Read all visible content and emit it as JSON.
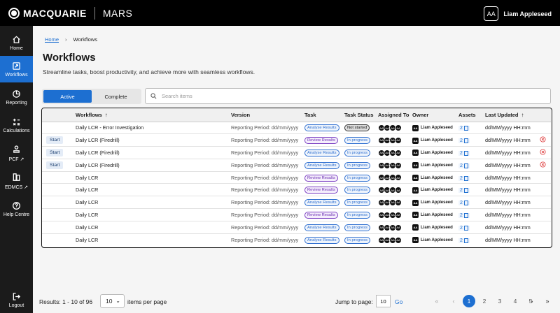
{
  "header": {
    "brand": "MACQUARIE",
    "app": "MARS",
    "user_initials": "AA",
    "user_name": "Liam Appleseed"
  },
  "sidebar": {
    "items": [
      {
        "label": "Home",
        "icon": "home-icon",
        "active": false
      },
      {
        "label": "Workflows",
        "icon": "workflow-icon",
        "active": true
      },
      {
        "label": "Reporting",
        "icon": "chart-icon",
        "active": false
      },
      {
        "label": "Calculations",
        "icon": "calculator-icon",
        "active": false
      },
      {
        "label": "PCF",
        "icon": "person-icon",
        "active": false,
        "external": true
      },
      {
        "label": "EDMCS",
        "icon": "building-icon",
        "active": false,
        "external": true
      },
      {
        "label": "Help Centre",
        "icon": "help-icon",
        "active": false
      }
    ],
    "logout": "Logout"
  },
  "breadcrumb": {
    "home": "Home",
    "current": "Workflows"
  },
  "page": {
    "title": "Workflows",
    "subtitle": "Streamline tasks, boost productivity, and achieve more with seamless workflows."
  },
  "tabs": {
    "active": "Active",
    "complete": "Complete"
  },
  "search": {
    "placeholder": "Search items",
    "value": ""
  },
  "table": {
    "columns": [
      "Workflows",
      "Version",
      "Task",
      "Task Status",
      "Assigned To",
      "Owner",
      "Assets",
      "Last Updated"
    ],
    "rows": [
      {
        "start": "",
        "workflow": "Daily LCR - Error Investigation",
        "version": "Reporting Period: dd/mm/yyyy",
        "task": "Analyse Results",
        "status": "Not started",
        "assignees": [
          "AA",
          "AA",
          "AA",
          "AA"
        ],
        "owner_initials": "AA",
        "owner": "Liam Appleseed",
        "assets": "2",
        "updated": "dd/MM/yyyy HH:mm",
        "removable": false
      },
      {
        "start": "Start",
        "workflow": "Daily LCR (Firedrill)",
        "version": "Reporting Period: dd/mm/yyyy",
        "task": "Review Results",
        "status": "In progress",
        "assignees": [
          "AA",
          "AA",
          "AA",
          "AA"
        ],
        "owner_initials": "AA",
        "owner": "Liam Appleseed",
        "assets": "2",
        "updated": "dd/MM/yyyy HH:mm",
        "removable": true
      },
      {
        "start": "Start",
        "workflow": "Daily LCR (Firedrill)",
        "version": "Reporting Period: dd/mm/yyyy",
        "task": "Analyse Results",
        "status": "In progress",
        "assignees": [
          "AA",
          "AA",
          "AA",
          "AA"
        ],
        "owner_initials": "AA",
        "owner": "Liam Appleseed",
        "assets": "2",
        "updated": "dd/MM/yyyy HH:mm",
        "removable": true
      },
      {
        "start": "Start",
        "workflow": "Daily LCR (Firedrill)",
        "version": "Reporting Period: dd/mm/yyyy",
        "task": "Analyse Results",
        "status": "In progress",
        "assignees": [
          "AA",
          "AA",
          "AA",
          "AA"
        ],
        "owner_initials": "AA",
        "owner": "Liam Appleseed",
        "assets": "2",
        "updated": "dd/MM/yyyy HH:mm",
        "removable": true
      },
      {
        "start": "",
        "workflow": "Daily LCR",
        "version": "Reporting Period: dd/mm/yyyy",
        "task": "Review Results",
        "status": "In progress",
        "assignees": [
          "AA",
          "AA",
          "AA",
          "AA"
        ],
        "owner_initials": "AA",
        "owner": "Liam Appleseed",
        "assets": "2",
        "updated": "dd/MM/yyyy HH:mm",
        "removable": false
      },
      {
        "start": "",
        "workflow": "Daily LCR",
        "version": "Reporting Period: dd/mm/yyyy",
        "task": "Review Results",
        "status": "In progress",
        "assignees": [
          "AA",
          "AA",
          "AA",
          "AA"
        ],
        "owner_initials": "AA",
        "owner": "Liam Appleseed",
        "assets": "2",
        "updated": "dd/MM/yyyy HH:mm",
        "removable": false
      },
      {
        "start": "",
        "workflow": "Daily LCR",
        "version": "Reporting Period: dd/mm/yyyy",
        "task": "Analyse Results",
        "status": "In progress",
        "assignees": [
          "AA",
          "AA",
          "AA",
          "AA"
        ],
        "owner_initials": "AA",
        "owner": "Liam Appleseed",
        "assets": "2",
        "updated": "dd/MM/yyyy HH:mm",
        "removable": false
      },
      {
        "start": "",
        "workflow": "Daily LCR",
        "version": "Reporting Period: dd/mm/yyyy",
        "task": "Review Results",
        "status": "In progress",
        "assignees": [
          "AA",
          "AA",
          "AA",
          "AA"
        ],
        "owner_initials": "AA",
        "owner": "Liam Appleseed",
        "assets": "2",
        "updated": "dd/MM/yyyy HH:mm",
        "removable": false
      },
      {
        "start": "",
        "workflow": "Daily LCR",
        "version": "Reporting Period: dd/mm/yyyy",
        "task": "Analyse Results",
        "status": "In progress",
        "assignees": [
          "AA",
          "AA",
          "AA",
          "AA"
        ],
        "owner_initials": "AA",
        "owner": "Liam Appleseed",
        "assets": "2",
        "updated": "dd/MM/yyyy HH:mm",
        "removable": false
      },
      {
        "start": "",
        "workflow": "Daily LCR",
        "version": "Reporting Period: dd/mm/yyyy",
        "task": "Analyse Results",
        "status": "In progress",
        "assignees": [
          "AA",
          "AA",
          "AA",
          "AA"
        ],
        "owner_initials": "AA",
        "owner": "Liam Appleseed",
        "assets": "2",
        "updated": "dd/MM/yyyy HH:mm",
        "removable": false
      }
    ]
  },
  "pagination": {
    "results": "Results: 1 - 10 of 96",
    "per_page": "10",
    "per_page_label": "items per page",
    "jump_label": "Jump to page:",
    "jump_value": "10",
    "go": "Go",
    "pages": [
      "1",
      "2",
      "3",
      "4",
      "5"
    ],
    "current": "1"
  },
  "colors": {
    "accent": "#1d6fd1",
    "topbar": "#000000",
    "sidebar": "#1b1b1b"
  }
}
